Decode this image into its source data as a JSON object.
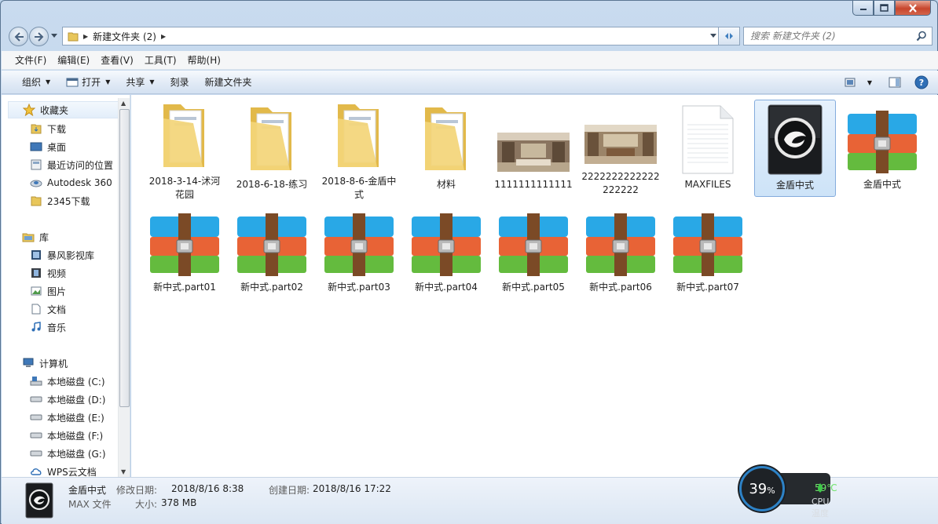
{
  "window": {
    "minimize_icon": "minimize-icon",
    "maximize_icon": "maximize-icon",
    "close_icon": "close-icon"
  },
  "address": {
    "path": "新建文件夹 (2)",
    "search_placeholder": "搜索 新建文件夹 (2)"
  },
  "menu": [
    "文件(F)",
    "编辑(E)",
    "查看(V)",
    "工具(T)",
    "帮助(H)"
  ],
  "toolbar": {
    "organize": "组织",
    "open": "打开",
    "share": "共享",
    "burn": "刻录",
    "new_folder": "新建文件夹"
  },
  "nav": {
    "favorites": "收藏夹",
    "downloads": "下载",
    "desktop": "桌面",
    "recent": "最近访问的位置",
    "autodesk": "Autodesk 360",
    "dl2345": "2345下载",
    "libraries": "库",
    "baofeng": "暴风影视库",
    "videos": "视频",
    "pictures": "图片",
    "documents": "文档",
    "music": "音乐",
    "computer": "计算机",
    "disk_c": "本地磁盘 (C:)",
    "disk_d": "本地磁盘 (D:)",
    "disk_e": "本地磁盘 (E:)",
    "disk_f": "本地磁盘 (F:)",
    "disk_g": "本地磁盘 (G:)",
    "wps": "WPS云文档"
  },
  "files": [
    {
      "name": "2018-3-14-沭河花园",
      "type": "folder"
    },
    {
      "name": "2018-6-18-练习",
      "type": "folder"
    },
    {
      "name": "2018-8-6-金盾中式",
      "type": "folder"
    },
    {
      "name": "材料",
      "type": "folder"
    },
    {
      "name": "1111111111111",
      "type": "image"
    },
    {
      "name": "2222222222222222222",
      "type": "image"
    },
    {
      "name": "MAXFILES",
      "type": "blank"
    },
    {
      "name": "金盾中式",
      "type": "max",
      "selected": true
    },
    {
      "name": "金盾中式",
      "type": "rar"
    },
    {
      "name": "新中式.part01",
      "type": "rar"
    },
    {
      "name": "新中式.part02",
      "type": "rar"
    },
    {
      "name": "新中式.part03",
      "type": "rar"
    },
    {
      "name": "新中式.part04",
      "type": "rar"
    },
    {
      "name": "新中式.part05",
      "type": "rar"
    },
    {
      "name": "新中式.part06",
      "type": "rar"
    },
    {
      "name": "新中式.part07",
      "type": "rar"
    }
  ],
  "status": {
    "name": "金盾中式",
    "type": "MAX 文件",
    "modified_label": "修改日期:",
    "modified": "2018/8/16 8:38",
    "created_label": "创建日期:",
    "created": "2018/8/16 17:22",
    "size_label": "大小:",
    "size": "378 MB"
  },
  "cpu": {
    "percent": "39",
    "percent_sign": "%",
    "temp": "59℃",
    "label": "CPU温度"
  },
  "colors": {
    "accent": "#2d82c6",
    "temp_green": "#6fe36b",
    "selection": "#cde3f8"
  }
}
